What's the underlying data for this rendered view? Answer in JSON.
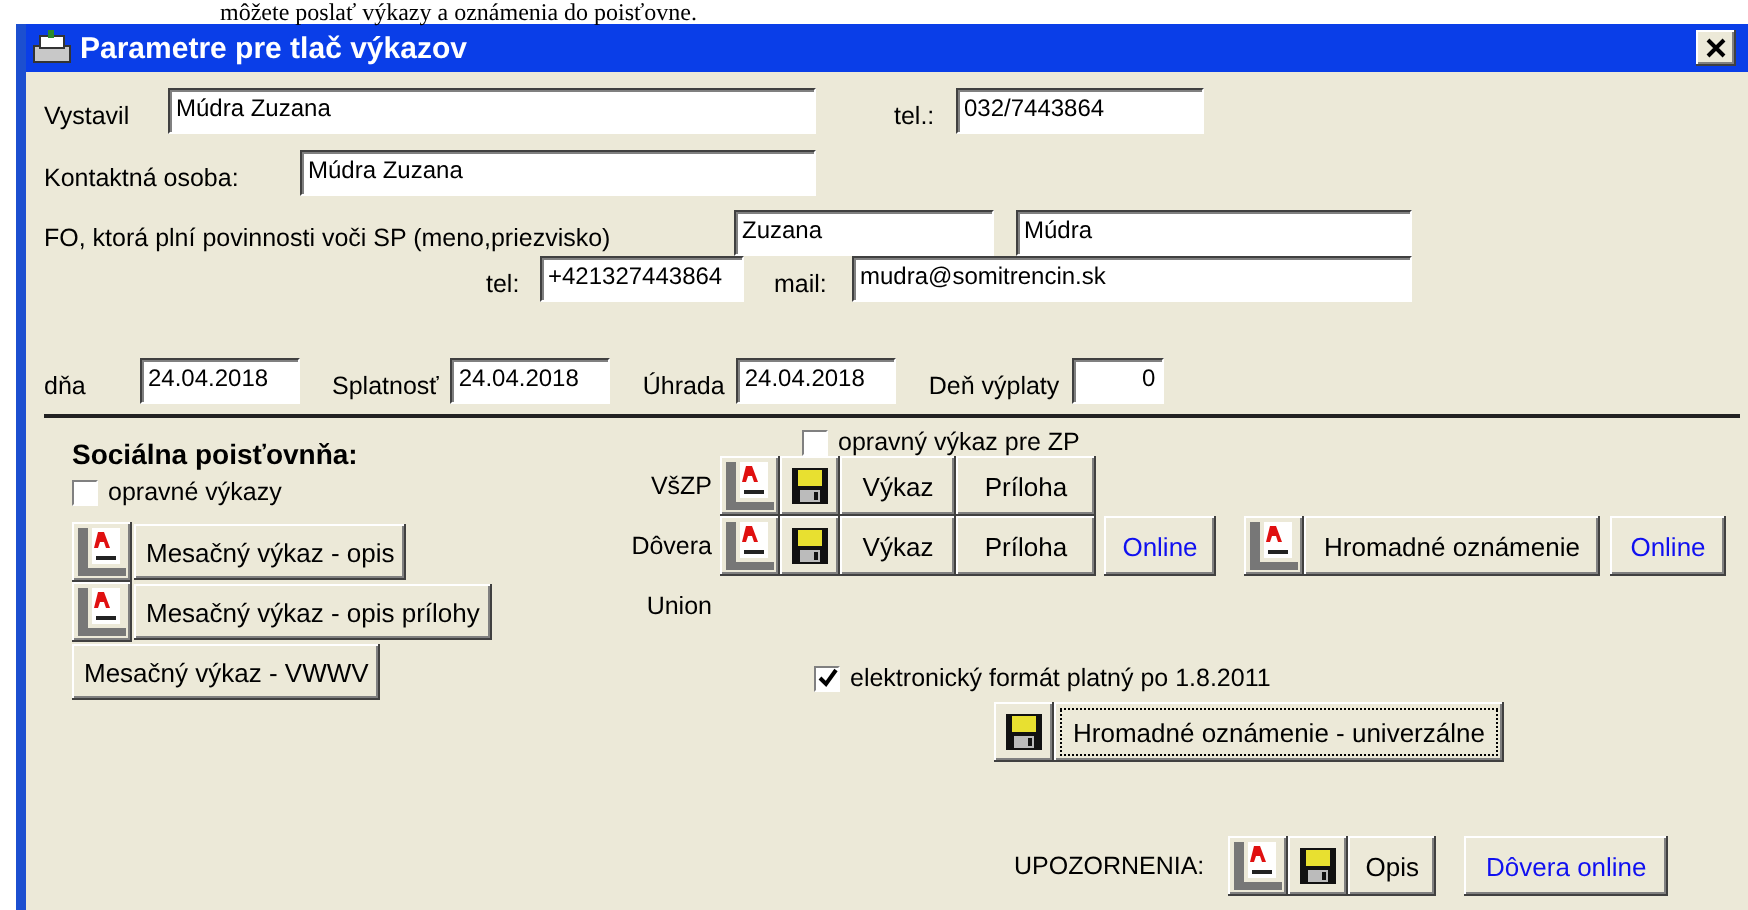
{
  "page_text": "môžete poslať výkazy a oznámenia do poisťovne.",
  "window": {
    "title": "Parametre pre tlač výkazov"
  },
  "issuer": {
    "label": "Vystavil",
    "value": "Múdra Zuzana"
  },
  "issuer_phone": {
    "label": "tel.:",
    "value": "032/7443864"
  },
  "contact": {
    "label": "Kontaktná osoba:",
    "value": "Múdra Zuzana"
  },
  "person": {
    "label": "FO, ktorá plní povinnosti voči SP (meno,priezvisko)",
    "first_name": "Zuzana",
    "last_name": "Múdra"
  },
  "person_phone": {
    "label": "tel:",
    "value": "+421327443864"
  },
  "person_mail": {
    "label": "mail:",
    "value": "mudra@somitrencin.sk"
  },
  "dates": [
    {
      "label": "dňa",
      "value": "24.04.2018"
    },
    {
      "label": "Splatnosť",
      "value": "24.04.2018"
    },
    {
      "label": "Úhrada",
      "value": "24.04.2018"
    },
    {
      "label": "Deň výplaty",
      "value": "0"
    }
  ],
  "social": {
    "heading": "Sociálna poisťovnňa:",
    "correction": {
      "label": "opravné výkazy",
      "checked": false
    },
    "buttons": [
      {
        "label": "Mesačný výkaz - opis",
        "pdf": true
      },
      {
        "label": "Mesačný výkaz - opis prílohy",
        "pdf": true
      },
      {
        "label": "Mesačný výkaz - VWWV",
        "pdf": false
      }
    ]
  },
  "health": {
    "correction": {
      "label": "opravný výkaz pre ZP",
      "checked": false
    },
    "insurers": [
      {
        "name": "VšZP",
        "buttons": [
          "Výkaz",
          "Príloha"
        ]
      },
      {
        "name": "Dôvera",
        "buttons": [
          "Výkaz",
          "Príloha"
        ],
        "online": "Online",
        "bulk": "Hromadné oznámenie",
        "bulk_online": "Online"
      },
      {
        "name": "Union"
      }
    ],
    "electronic": {
      "label": "elektronický formát platný po 1.8.2011",
      "checked": true
    },
    "universal": "Hromadné oznámenie - univerzálne"
  },
  "warnings": {
    "label": "UPOZORNENIA:",
    "button": "Opis",
    "online": "Dôvera online"
  }
}
